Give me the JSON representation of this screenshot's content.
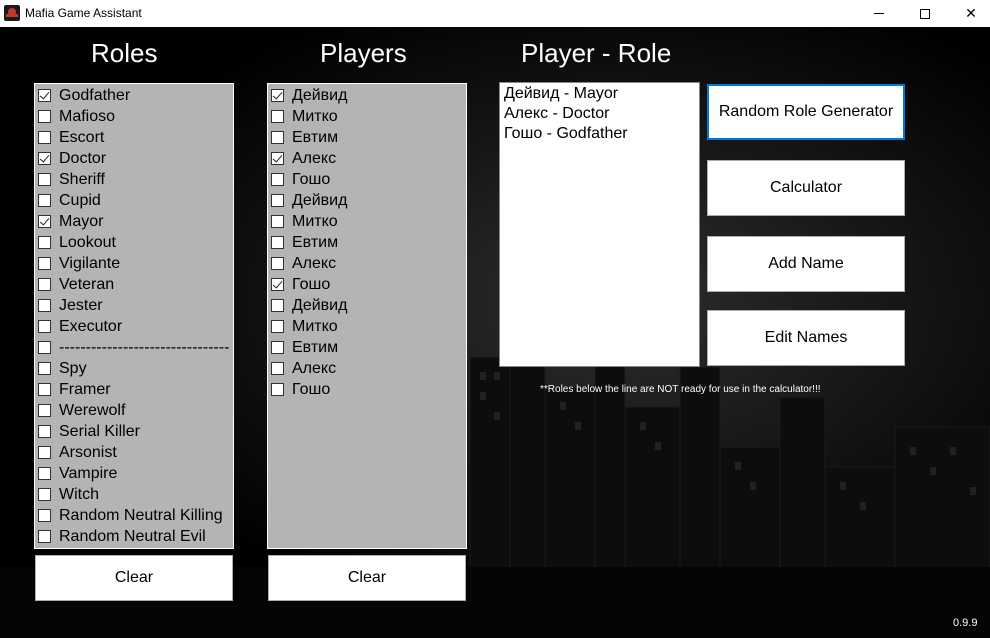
{
  "window": {
    "title": "Mafia Game Assistant",
    "minimize_icon": "minimize-icon",
    "maximize_icon": "maximize-icon",
    "close_glyph": "✕"
  },
  "headings": {
    "roles": "Roles",
    "players": "Players",
    "player_role": "Player - Role"
  },
  "roles": [
    {
      "label": "Godfather",
      "checked": true
    },
    {
      "label": "Mafioso",
      "checked": false
    },
    {
      "label": "Escort",
      "checked": false
    },
    {
      "label": "Doctor",
      "checked": true
    },
    {
      "label": "Sheriff",
      "checked": false
    },
    {
      "label": "Cupid",
      "checked": false
    },
    {
      "label": "Mayor",
      "checked": true
    },
    {
      "label": "Lookout",
      "checked": false
    },
    {
      "label": "Vigilante",
      "checked": false
    },
    {
      "label": "Veteran",
      "checked": false
    },
    {
      "label": "Jester",
      "checked": false
    },
    {
      "label": "Executor",
      "checked": false
    },
    {
      "label": "--------------------------------",
      "checked": false
    },
    {
      "label": "Spy",
      "checked": false
    },
    {
      "label": "Framer",
      "checked": false
    },
    {
      "label": "Werewolf",
      "checked": false
    },
    {
      "label": "Serial Killer",
      "checked": false
    },
    {
      "label": "Arsonist",
      "checked": false
    },
    {
      "label": "Vampire",
      "checked": false
    },
    {
      "label": "Witch",
      "checked": false
    },
    {
      "label": "Random Neutral Killing",
      "checked": false
    },
    {
      "label": "Random Neutral Evil",
      "checked": false
    }
  ],
  "players": [
    {
      "label": "Дейвид",
      "checked": true
    },
    {
      "label": "Митко",
      "checked": false
    },
    {
      "label": "Евтим",
      "checked": false
    },
    {
      "label": "Алекс",
      "checked": true
    },
    {
      "label": "Гошо",
      "checked": false
    },
    {
      "label": "Дейвид",
      "checked": false
    },
    {
      "label": "Митко",
      "checked": false
    },
    {
      "label": "Евтим",
      "checked": false
    },
    {
      "label": "Алекс",
      "checked": false
    },
    {
      "label": "Гошо",
      "checked": true
    },
    {
      "label": "Дейвид",
      "checked": false
    },
    {
      "label": "Митко",
      "checked": false
    },
    {
      "label": "Евтим",
      "checked": false
    },
    {
      "label": "Алекс",
      "checked": false
    },
    {
      "label": "Гошо",
      "checked": false
    }
  ],
  "assignments": [
    "Дейвид - Mayor",
    "Алекс - Doctor",
    "Гошо - Godfather"
  ],
  "buttons": {
    "random_role_generator": "Random Role Generator",
    "calculator": "Calculator",
    "add_name": "Add Name",
    "edit_names": "Edit Names",
    "clear_roles": "Clear",
    "clear_players": "Clear"
  },
  "note": "**Roles below the line are NOT ready for use in the calculator!!!",
  "version": "0.9.9",
  "colors": {
    "background": "#000000",
    "listbox_bg": "#b4b4b4",
    "focus_border": "#0078d7"
  }
}
